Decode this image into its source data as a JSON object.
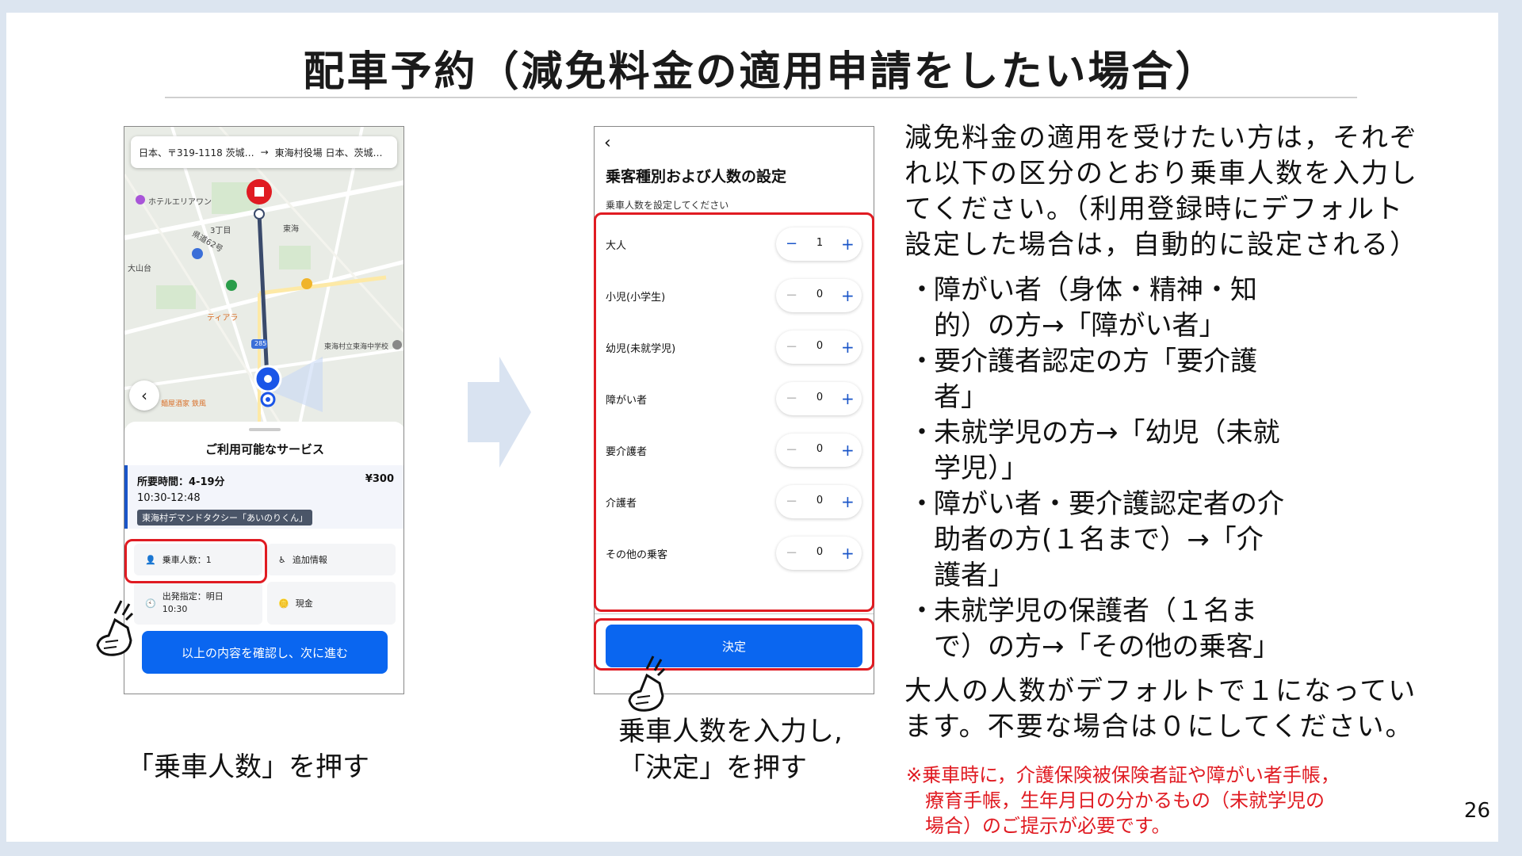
{
  "slide": {
    "title": "配車予約（減免料金の適用申請をしたい場合）",
    "page_number": "26"
  },
  "phone1": {
    "address_from": "日本、〒319-1118 茨城…",
    "address_arrow": "→",
    "address_to": "東海村役場 日本、茨城…",
    "map_labels": {
      "hotel": "ホテルエリアワン",
      "chome": "3丁目",
      "tokai": "東海",
      "oyamadai": "大山台",
      "tiara": "ティアラ",
      "school": "東海村立東海中学校",
      "izakaya": "麺屋酒家 鉄風",
      "road62": "県道62号",
      "route": "285"
    },
    "sheet_title": "ご利用可能なサービス",
    "service_time": "所要時間：4-19分",
    "service_price": "¥300",
    "service_range": "10:30-12:48",
    "service_name": "東海村デマンドタクシー「あいのりくん」",
    "passengers_label": "乗車人数：1",
    "extra_info_label": "追加情報",
    "departure_label": "出発指定：明日",
    "departure_time": "10:30",
    "payment_label": "現金",
    "confirm_button": "以上の内容を確認し、次に進む"
  },
  "caption1": "「乗車人数」を押す",
  "phone2": {
    "back_icon": "‹",
    "title": "乗客種別および人数の設定",
    "subtitle": "乗車人数を設定してください",
    "rows": [
      {
        "label": "大人",
        "value": "1"
      },
      {
        "label": "小児(小学生)",
        "value": "0"
      },
      {
        "label": "幼児(未就学児)",
        "value": "0"
      },
      {
        "label": "障がい者",
        "value": "0"
      },
      {
        "label": "要介護者",
        "value": "0"
      },
      {
        "label": "介護者",
        "value": "0"
      },
      {
        "label": "その他の乗客",
        "value": "0"
      }
    ],
    "decide_button": "決定"
  },
  "caption2": {
    "line1": "乗車人数を入力し,",
    "line2": "「決定」を押す"
  },
  "instructions": {
    "lines": [
      "減免料金の適用を受けたい方は，それぞ",
      "れ以下の区分のとおり乗車人数を入力し",
      "てください。（利用登録時にデフォルト",
      "設定した場合は，自動的に設定される）"
    ],
    "bullets": [
      {
        "line1": "障がい者（身体・精神・知",
        "line2": "的）の方→「障がい者」"
      },
      {
        "line1": "要介護者認定の方「要介護",
        "line2": "者」"
      },
      {
        "line1": "未就学児の方→「幼児（未就",
        "line2": "学児）」"
      },
      {
        "line1": "障がい者・要介護認定者の介",
        "line2": "助者の方(１名まで）→「介",
        "line3": "護者」"
      },
      {
        "line1": "未就学児の保護者（１名ま",
        "line2": "で）の方→「その他の乗客」"
      }
    ],
    "bullet_mark": "・",
    "bottom_line1": "大人の人数がデフォルトで１になってい",
    "bottom_line2": "ます。不要な場合は０にしてください。",
    "note_line1": "※乗車時に，介護保険被保険者証や障がい者手帳，",
    "note_line2": "療育手帳，生年月日の分かるもの（未就学児の",
    "note_line3": "場合）のご提示が必要です。"
  },
  "colors": {
    "accent_blue": "#0a66f0",
    "highlight_red": "#e01b22",
    "slide_bg": "#dce5f0"
  }
}
